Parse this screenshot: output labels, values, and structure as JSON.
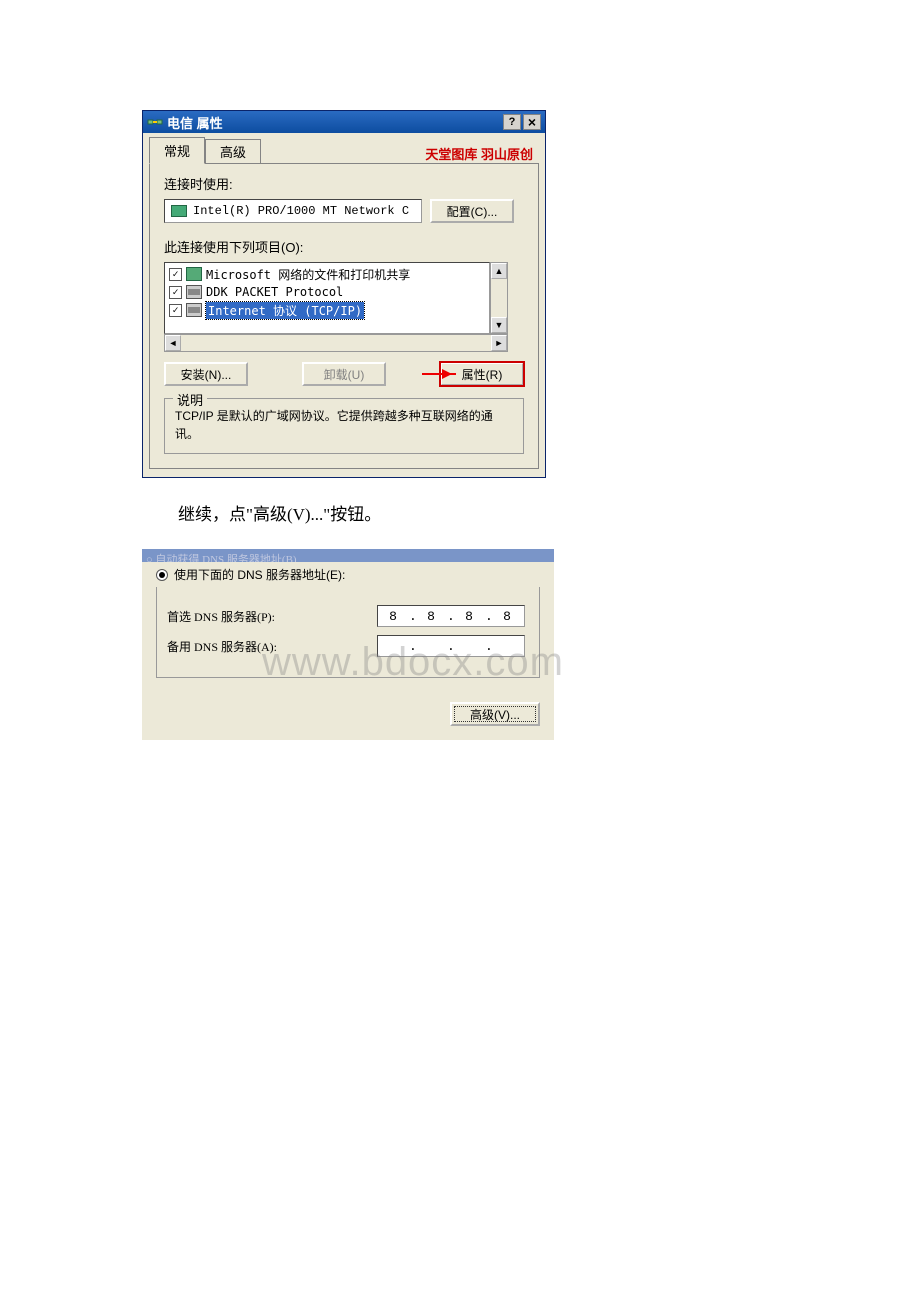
{
  "dialog1": {
    "title": "电信 属性",
    "tabs": {
      "general": "常规",
      "advanced": "高级"
    },
    "flash_text": "天堂图库 羽山原创",
    "connect_using": "连接时使用:",
    "adapter": "Intel(R) PRO/1000 MT Network C",
    "configure_btn": "配置(C)...",
    "items_label": "此连接使用下列项目(O):",
    "items": [
      {
        "checked": true,
        "label": "Microsoft 网络的文件和打印机共享"
      },
      {
        "checked": true,
        "label": "DDK PACKET Protocol"
      },
      {
        "checked": true,
        "label": "Internet 协议 (TCP/IP)",
        "selected": true
      }
    ],
    "install_btn": "安装(N)...",
    "uninstall_btn": "卸载(U)",
    "properties_btn": "属性(R)",
    "desc_legend": "说明",
    "desc_text": "TCP/IP 是默认的广域网协议。它提供跨越多种互联网络的通讯。"
  },
  "body_text": "继续，点\"高级(V)...\"按钮。",
  "dialog2": {
    "cutoff_radio": "自动获得 DNS 服务器地址(B)",
    "use_dns_radio": "使用下面的 DNS 服务器地址(E):",
    "preferred_label": "首选 DNS 服务器(P):",
    "preferred_ip": [
      "8",
      "8",
      "8",
      "8"
    ],
    "alternate_label": "备用 DNS 服务器(A):",
    "alternate_ip": [
      "",
      "",
      "",
      ""
    ],
    "advanced_btn": "高级(V)...",
    "watermark": "www.bdocx.com"
  }
}
